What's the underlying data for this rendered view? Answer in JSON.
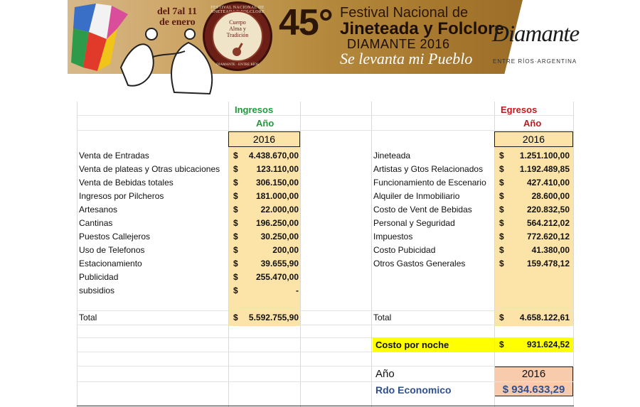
{
  "banner": {
    "date_line1": "del 7al 11",
    "date_line2": "de enero",
    "seal_ring": "FESTIVAL NACIONAL DE JINETEADA Y FOLCLORE",
    "seal_motto": [
      "Cuerpo",
      "Alma y",
      "Tradición"
    ],
    "seal_bottom": "DIAMANTE · ENTRE RÍOS",
    "edition": "45°",
    "title_line1": "Festival Nacional de",
    "title_line2": "Jineteada y Folclore",
    "title_line3": "DIAMANTE 2016",
    "slogan": "Se levanta mi Pueblo",
    "brand": "Diamante",
    "brand_sub": "ENTRE RÍOS·ARGENTINA",
    "colors": {
      "gold": "#b58a3e",
      "dark_brown": "#2b1608",
      "seal": "#6b1f16"
    }
  },
  "ingresos": {
    "header": "Ingresos",
    "year_label": "Año",
    "year": "2016",
    "rows": [
      {
        "label": "Venta de Entradas",
        "currency": "$",
        "value": "4.438.670,00"
      },
      {
        "label": "Venta de plateas y Otras ubicaciones",
        "currency": "$",
        "value": "123.110,00"
      },
      {
        "label": "Venta de Bebidas totales",
        "currency": "$",
        "value": "306.150,00"
      },
      {
        "label": "Ingresos por Pilcheros",
        "currency": "$",
        "value": "181.000,00"
      },
      {
        "label": "Artesanos",
        "currency": "$",
        "value": "22.000,00"
      },
      {
        "label": "Cantinas",
        "currency": "$",
        "value": "196.250,00"
      },
      {
        "label": "Puestos Callejeros",
        "currency": "$",
        "value": "30.250,00"
      },
      {
        "label": "Uso de Telefonos",
        "currency": "$",
        "value": "200,00"
      },
      {
        "label": "Estacionamiento",
        "currency": "$",
        "value": "39.655,90"
      },
      {
        "label": "Publicidad",
        "currency": "$",
        "value": "255.470,00"
      },
      {
        "label": "subsidios",
        "currency": "$",
        "value": "-"
      }
    ],
    "total_label": "Total",
    "total_currency": "$",
    "total_value": "5.592.755,90"
  },
  "egresos": {
    "header": "Egresos",
    "year_label": "Año",
    "year": "2016",
    "rows": [
      {
        "label": "Jineteada",
        "currency": "$",
        "value": "1.251.100,00"
      },
      {
        "label": "Artistas y Gtos Relacionados",
        "currency": "$",
        "value": "1.192.489,85"
      },
      {
        "label": "Funcionamiento de Escenario",
        "currency": "$",
        "value": "427.410,00"
      },
      {
        "label": "Alquiler de Inmobiliario",
        "currency": "$",
        "value": "28.600,00"
      },
      {
        "label": "Costo de Vent de Bebidas",
        "currency": "$",
        "value": "220.832,50"
      },
      {
        "label": "Personal y Seguridad",
        "currency": "$",
        "value": "564.212,02"
      },
      {
        "label": "Impuestos",
        "currency": "$",
        "value": "772.620,12"
      },
      {
        "label": "Costo Pubicidad",
        "currency": "$",
        "value": "41.380,00"
      },
      {
        "label": "Otros Gastos Generales",
        "currency": "$",
        "value": "159.478,12"
      }
    ],
    "total_label": "Total",
    "total_currency": "$",
    "total_value": "4.658.122,61"
  },
  "costo_noche": {
    "label": "Costo por noche",
    "currency": "$",
    "value": "931.624,52"
  },
  "resultado": {
    "year_label": "Año",
    "year": "2016",
    "label": "Rdo Economico",
    "value": "$ 934.633,29"
  },
  "colors": {
    "green_header": "#1f9a3a",
    "red_header": "#c0191b",
    "column_fill": "#fce4a8",
    "highlight": "#ffff00",
    "result_fill": "#f8cbad",
    "result_text": "#2f4f8f"
  }
}
